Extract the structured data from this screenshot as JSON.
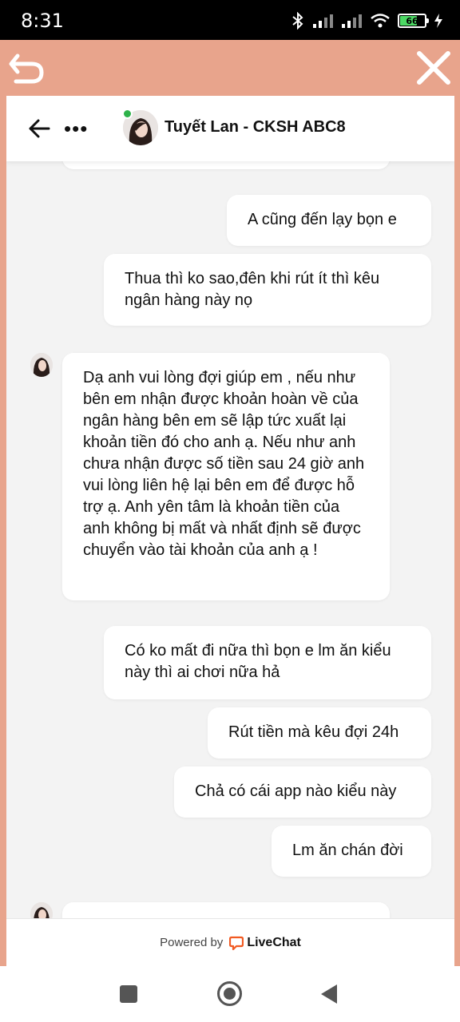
{
  "status_bar": {
    "time": "8:31",
    "battery_level": "66",
    "icons": [
      "bluetooth-icon",
      "signal-icon",
      "signal-icon",
      "wifi-icon",
      "battery-icon",
      "charging-icon"
    ]
  },
  "toolbar": {
    "back_icon": "undo-arrow-icon",
    "close_icon": "close-icon",
    "accent_color": "#e8a48c"
  },
  "chat_header": {
    "agent_name": "Tuyết Lan - CKSH ABC8",
    "more_label": "•••",
    "online_color": "#2eb24a"
  },
  "messages": [
    {
      "from": "visitor",
      "text": "A cũng đến lạy bọn e"
    },
    {
      "from": "visitor",
      "text": "Thua thì ko sao,đên khi rút ít thì kêu ngân hàng này nọ"
    },
    {
      "from": "agent",
      "text": "Dạ anh vui lòng đợi giúp em , nếu như bên em nhận được khoản hoàn về của ngân hàng bên em sẽ lập tức xuất lại khoản tiền đó cho anh ạ. Nếu như anh chưa nhận được số tiền sau 24 giờ anh vui lòng liên hệ lại bên em để được hỗ trợ ạ. Anh yên tâm là khoản tiền của anh không bị mất và nhất định sẽ được chuyển vào tài khoản của anh ạ !"
    },
    {
      "from": "visitor",
      "text": "Có ko mất đi nữa thì bọn e lm ăn kiểu này thì ai chơi nữa hả"
    },
    {
      "from": "visitor",
      "text": "Rút tiền mà kêu đợi 24h"
    },
    {
      "from": "visitor",
      "text": "Chả có cái app nào kiểu này"
    },
    {
      "from": "visitor",
      "text": "Lm ăn chán đời"
    }
  ],
  "footer": {
    "powered_by": "Powered by",
    "brand": "LiveChat",
    "brand_color": "#f15a22"
  }
}
